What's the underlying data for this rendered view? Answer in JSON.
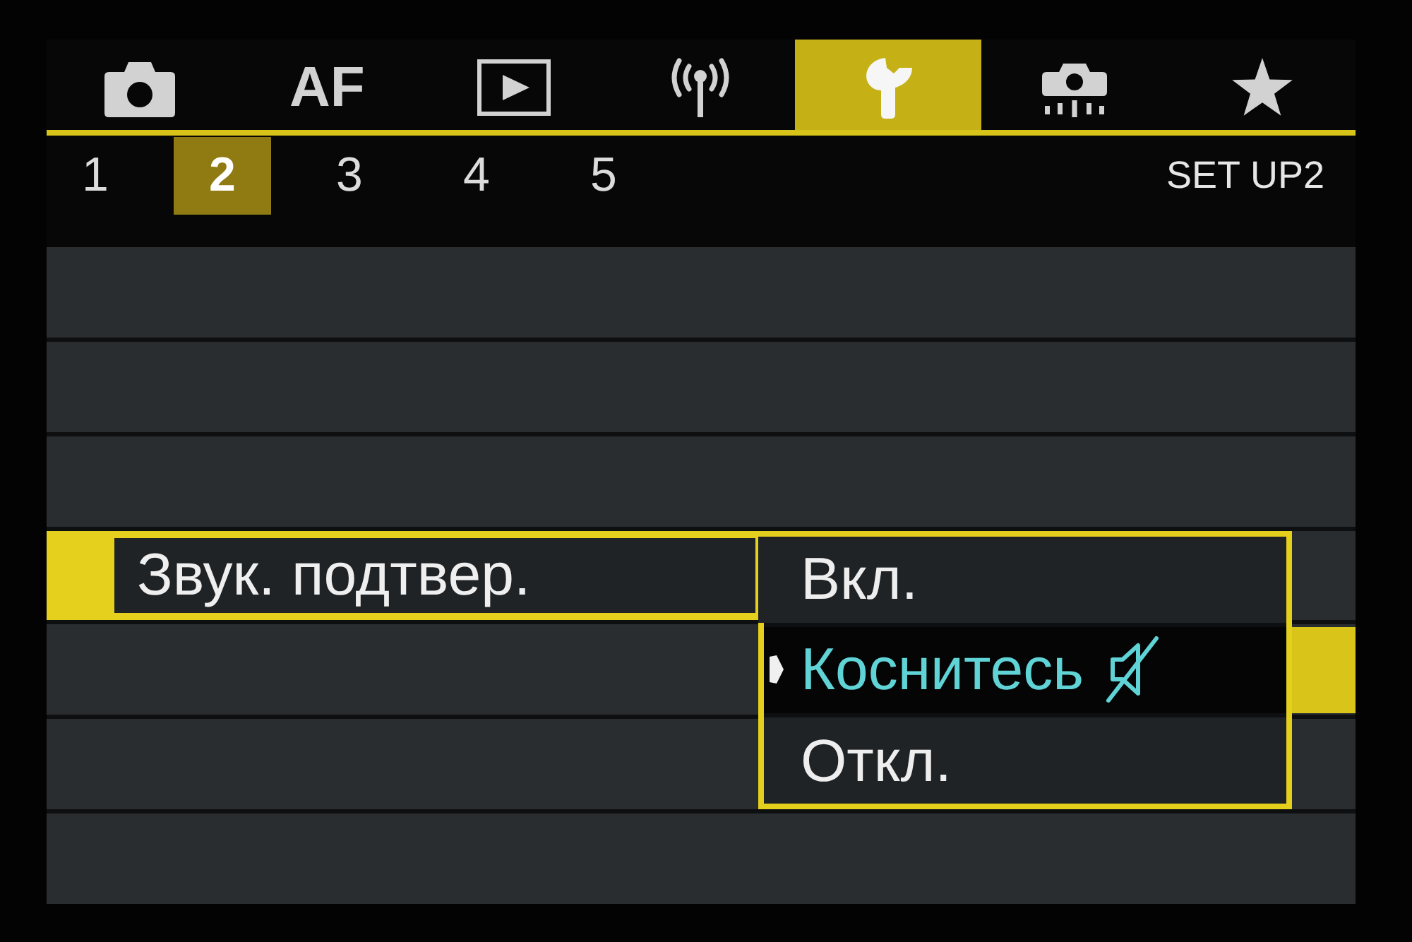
{
  "main_tabs": [
    {
      "kind": "camera",
      "selected": false
    },
    {
      "kind": "text",
      "label": "AF",
      "selected": false
    },
    {
      "kind": "play",
      "selected": false
    },
    {
      "kind": "antenna",
      "selected": false
    },
    {
      "kind": "wrench",
      "selected": true
    },
    {
      "kind": "dotcamera",
      "selected": false
    },
    {
      "kind": "star",
      "selected": false
    }
  ],
  "sub_tabs": [
    {
      "label": "1",
      "selected": false
    },
    {
      "label": "2",
      "selected": true
    },
    {
      "label": "3",
      "selected": false
    },
    {
      "label": "4",
      "selected": false
    },
    {
      "label": "5",
      "selected": false
    }
  ],
  "page_title": "SET UP2",
  "menu_rows": [
    {
      "selected": false
    },
    {
      "selected": false
    },
    {
      "selected": false
    },
    {
      "label": "Звук. подтвер.",
      "selected": true
    },
    {
      "selected": false
    },
    {
      "selected": false
    },
    {
      "selected": false
    }
  ],
  "options_popup": {
    "options": [
      {
        "label": "Вкл.",
        "kind": "text",
        "selected": false
      },
      {
        "label": "Коснитесь",
        "kind": "muted",
        "selected": true
      },
      {
        "label": "Откл.",
        "kind": "text",
        "selected": false
      }
    ]
  }
}
